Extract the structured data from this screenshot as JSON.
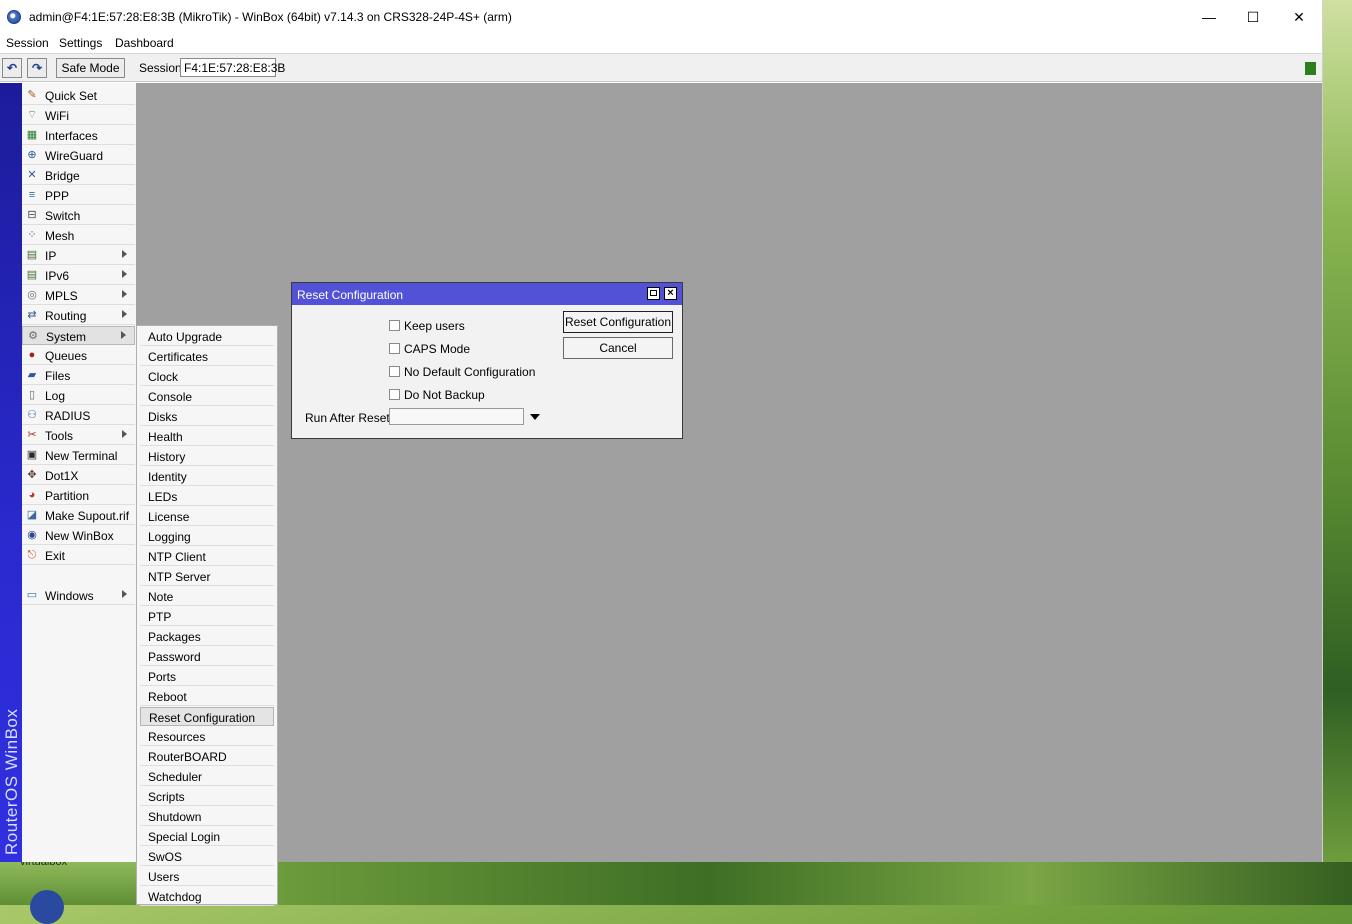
{
  "window": {
    "title": "admin@F4:1E:57:28:E8:3B (MikroTik) - WinBox (64bit) v7.14.3 on CRS328-24P-4S+ (arm)",
    "minimize": "—",
    "maximize": "☐",
    "close": "✕"
  },
  "menu": [
    "Session",
    "Settings",
    "Dashboard"
  ],
  "toolbar": {
    "undo_icon": "undo-icon",
    "redo_icon": "redo-icon",
    "undo_glyph": "↶",
    "redo_glyph": "↷",
    "safe_mode": "Safe Mode",
    "session_label": "Session:",
    "session_value": "F4:1E:57:28:E8:3B"
  },
  "brand": "RouterOS WinBox",
  "desktop_text": "virtualbox",
  "sidebar": {
    "items": [
      {
        "label": "Quick Set",
        "icon": "quick-set-icon",
        "glyph": "✎",
        "color": "#a06020"
      },
      {
        "label": "WiFi",
        "icon": "wifi-icon",
        "glyph": "⌔",
        "color": "#4a8a4a"
      },
      {
        "label": "Interfaces",
        "icon": "interfaces-icon",
        "glyph": "▦",
        "color": "#2a7a2a"
      },
      {
        "label": "WireGuard",
        "icon": "wireguard-icon",
        "glyph": "⊕",
        "color": "#2a5aa0"
      },
      {
        "label": "Bridge",
        "icon": "bridge-icon",
        "glyph": "✕",
        "color": "#3a5a8a"
      },
      {
        "label": "PPP",
        "icon": "ppp-icon",
        "glyph": "≡",
        "color": "#3a6a9a"
      },
      {
        "label": "Switch",
        "icon": "switch-icon",
        "glyph": "⊟",
        "color": "#4a4a4a"
      },
      {
        "label": "Mesh",
        "icon": "mesh-icon",
        "glyph": "⁘",
        "color": "#2a5a8a"
      },
      {
        "label": "IP",
        "icon": "ip-icon",
        "glyph": "▤",
        "color": "#4a6a3a",
        "submenu": true
      },
      {
        "label": "IPv6",
        "icon": "ipv6-icon",
        "glyph": "▤",
        "color": "#4a6a3a",
        "submenu": true
      },
      {
        "label": "MPLS",
        "icon": "mpls-icon",
        "glyph": "◎",
        "color": "#6a6a6a",
        "submenu": true
      },
      {
        "label": "Routing",
        "icon": "routing-icon",
        "glyph": "⇄",
        "color": "#3a5a8a",
        "submenu": true
      },
      {
        "label": "System",
        "icon": "system-icon",
        "glyph": "⚙",
        "color": "#6a6a6a",
        "submenu": true,
        "active": true
      },
      {
        "label": "Queues",
        "icon": "queues-icon",
        "glyph": "●",
        "color": "#a02020"
      },
      {
        "label": "Files",
        "icon": "files-icon",
        "glyph": "▰",
        "color": "#2a5aa0"
      },
      {
        "label": "Log",
        "icon": "log-icon",
        "glyph": "▯",
        "color": "#6a6a6a"
      },
      {
        "label": "RADIUS",
        "icon": "radius-icon",
        "glyph": "⚇",
        "color": "#3a6aa0"
      },
      {
        "label": "Tools",
        "icon": "tools-icon",
        "glyph": "✂",
        "color": "#a03020",
        "submenu": true
      },
      {
        "label": "New Terminal",
        "icon": "terminal-icon",
        "glyph": "▣",
        "color": "#2a2a2a"
      },
      {
        "label": "Dot1X",
        "icon": "dot1x-icon",
        "glyph": "✥",
        "color": "#5a3a2a"
      },
      {
        "label": "Partition",
        "icon": "partition-icon",
        "glyph": "◕",
        "color": "#c03030"
      },
      {
        "label": "Make Supout.rif",
        "icon": "supout-icon",
        "glyph": "◪",
        "color": "#3a6aa0"
      },
      {
        "label": "New WinBox",
        "icon": "new-winbox-icon",
        "glyph": "◉",
        "color": "#2a4a90"
      },
      {
        "label": "Exit",
        "icon": "exit-icon",
        "glyph": "⎋",
        "color": "#c05020"
      },
      {
        "label": "Windows",
        "icon": "windows-icon",
        "glyph": "▭",
        "color": "#3a6aa0",
        "submenu": true
      }
    ]
  },
  "submenu": {
    "items": [
      "Auto Upgrade",
      "Certificates",
      "Clock",
      "Console",
      "Disks",
      "Health",
      "History",
      "Identity",
      "LEDs",
      "License",
      "Logging",
      "NTP Client",
      "NTP Server",
      "Note",
      "PTP",
      "Packages",
      "Password",
      "Ports",
      "Reboot",
      "Reset Configuration",
      "Resources",
      "RouterBOARD",
      "Scheduler",
      "Scripts",
      "Shutdown",
      "Special Login",
      "SwOS",
      "Users",
      "Watchdog"
    ],
    "active": "Reset Configuration"
  },
  "dialog": {
    "title": "Reset Configuration",
    "checkboxes": [
      {
        "label": "Keep users",
        "checked": false
      },
      {
        "label": "CAPS Mode",
        "checked": false
      },
      {
        "label": "No Default Configuration",
        "checked": false
      },
      {
        "label": "Do Not Backup",
        "checked": false
      }
    ],
    "reset_button": "Reset Configuration",
    "cancel_button": "Cancel",
    "run_after_reset_label": "Run After Reset:",
    "run_after_reset_value": ""
  }
}
